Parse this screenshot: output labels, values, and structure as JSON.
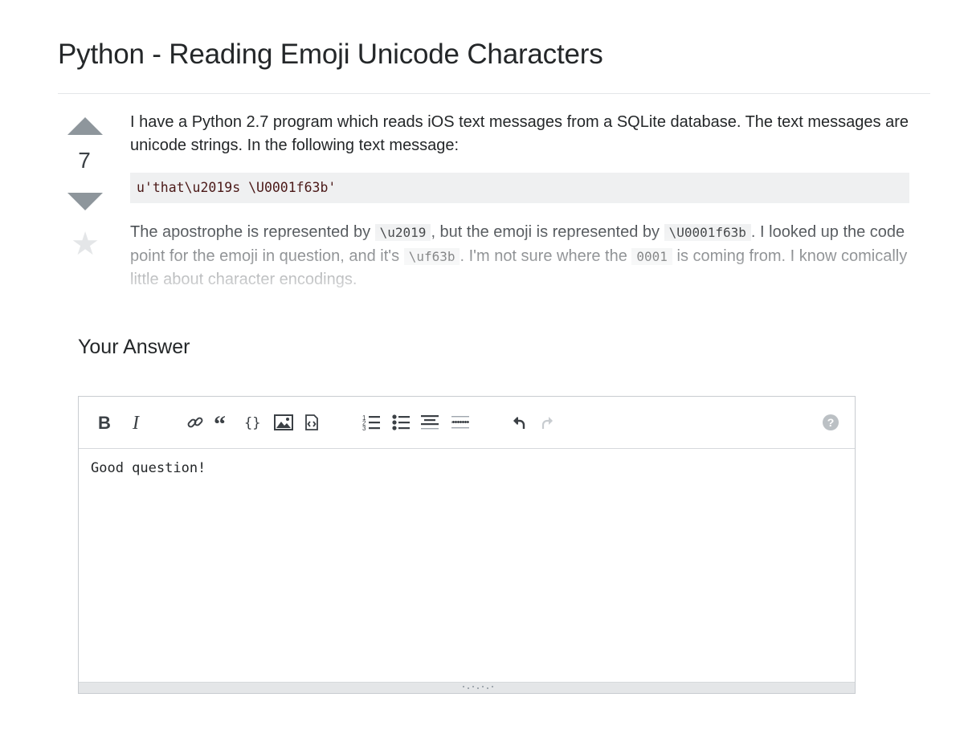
{
  "question": {
    "title": "Python - Reading Emoji Unicode Characters",
    "votes": "7",
    "paragraph1": "I have a Python 2.7 program which reads iOS text messages from a SQLite database. The text messages are unicode strings. In the following text message:",
    "code_block": "u'that\\u2019s \\U0001f63b'",
    "paragraph2": {
      "t1": "The apostrophe is represented by ",
      "c1": "\\u2019",
      "t2": ", but the emoji is represented by ",
      "c2": "\\U0001f63b",
      "t3": ". I looked up the code point for the emoji in question, and it's ",
      "c3": "\\uf63b",
      "t4": ". I'm not sure where the ",
      "c4": "0001",
      "t5": " is coming from. I know comically little about character encodings."
    }
  },
  "answer": {
    "heading": "Your Answer",
    "editor_text": "Good question!",
    "toolbar": [
      "bold-icon",
      "italic-icon",
      "link-icon",
      "blockquote-icon",
      "code-icon",
      "image-icon",
      "snippet-icon",
      "numbered-list-icon",
      "bulleted-list-icon",
      "heading-icon",
      "horizontal-rule-icon",
      "undo-icon",
      "redo-icon",
      "help-icon"
    ]
  },
  "colors": {
    "text": "#242729",
    "vote_arrow": "#8e969c",
    "star": "#e4e6e8",
    "code_bg": "#eff0f1",
    "code_text": "#4b1918",
    "border": "#c8ccd0"
  }
}
